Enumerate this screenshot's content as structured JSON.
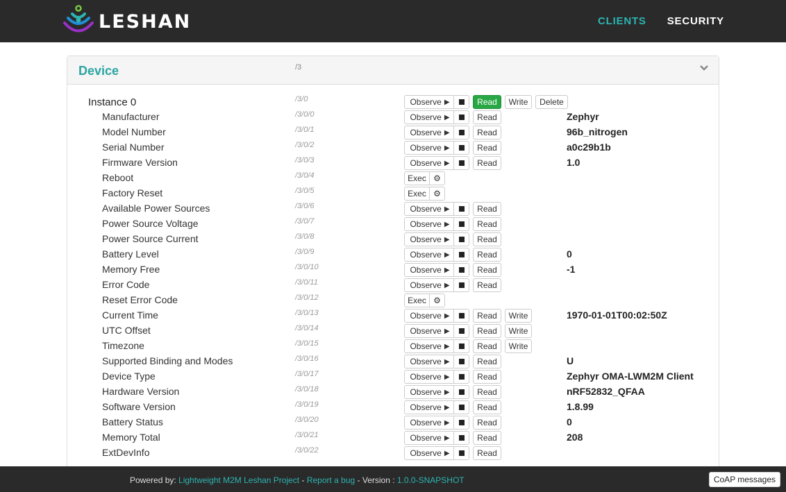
{
  "app": {
    "logo_text": "LESHAN",
    "nav": {
      "clients": "CLIENTS",
      "security": "SECURITY"
    }
  },
  "object": {
    "title": "Device",
    "path": "/3"
  },
  "labels": {
    "observe": "Observe",
    "read": "Read",
    "write": "Write",
    "delete": "Delete",
    "exec": "Exec"
  },
  "instance": {
    "name": "Instance 0",
    "path": "/3/0"
  },
  "resources": [
    {
      "name": "Manufacturer",
      "path": "/3/0/0",
      "value": "Zephyr"
    },
    {
      "name": "Model Number",
      "path": "/3/0/1",
      "value": "96b_nitrogen"
    },
    {
      "name": "Serial Number",
      "path": "/3/0/2",
      "value": "a0c29b1b"
    },
    {
      "name": "Firmware Version",
      "path": "/3/0/3",
      "value": "1.0"
    },
    {
      "name": "Reboot",
      "path": "/3/0/4",
      "value": ""
    },
    {
      "name": "Factory Reset",
      "path": "/3/0/5",
      "value": ""
    },
    {
      "name": "Available Power Sources",
      "path": "/3/0/6",
      "value": ""
    },
    {
      "name": "Power Source Voltage",
      "path": "/3/0/7",
      "value": ""
    },
    {
      "name": "Power Source Current",
      "path": "/3/0/8",
      "value": ""
    },
    {
      "name": "Battery Level",
      "path": "/3/0/9",
      "value": "0"
    },
    {
      "name": "Memory Free",
      "path": "/3/0/10",
      "value": "-1"
    },
    {
      "name": "Error Code",
      "path": "/3/0/11",
      "value": ""
    },
    {
      "name": "Reset Error Code",
      "path": "/3/0/12",
      "value": ""
    },
    {
      "name": "Current Time",
      "path": "/3/0/13",
      "value": "1970-01-01T00:02:50Z"
    },
    {
      "name": "UTC Offset",
      "path": "/3/0/14",
      "value": ""
    },
    {
      "name": "Timezone",
      "path": "/3/0/15",
      "value": ""
    },
    {
      "name": "Supported Binding and Modes",
      "path": "/3/0/16",
      "value": "U"
    },
    {
      "name": "Device Type",
      "path": "/3/0/17",
      "value": "Zephyr OMA-LWM2M Client"
    },
    {
      "name": "Hardware Version",
      "path": "/3/0/18",
      "value": "nRF52832_QFAA"
    },
    {
      "name": "Software Version",
      "path": "/3/0/19",
      "value": "1.8.99"
    },
    {
      "name": "Battery Status",
      "path": "/3/0/20",
      "value": "0"
    },
    {
      "name": "Memory Total",
      "path": "/3/0/21",
      "value": "208"
    },
    {
      "name": "ExtDevInfo",
      "path": "/3/0/22",
      "value": ""
    }
  ],
  "footer": {
    "powered_by": "Powered by: ",
    "project_link": "Lightweight M2M Leshan Project",
    "sep1": " - ",
    "bug_link": "Report a bug",
    "version_label": " - Version : ",
    "version": "1.0.0-SNAPSHOT",
    "coap_button": "CoAP messages"
  },
  "colors": {
    "accent": "#2cb5b1",
    "header_bg": "#2a2a2a",
    "read_active": "#28a745"
  }
}
